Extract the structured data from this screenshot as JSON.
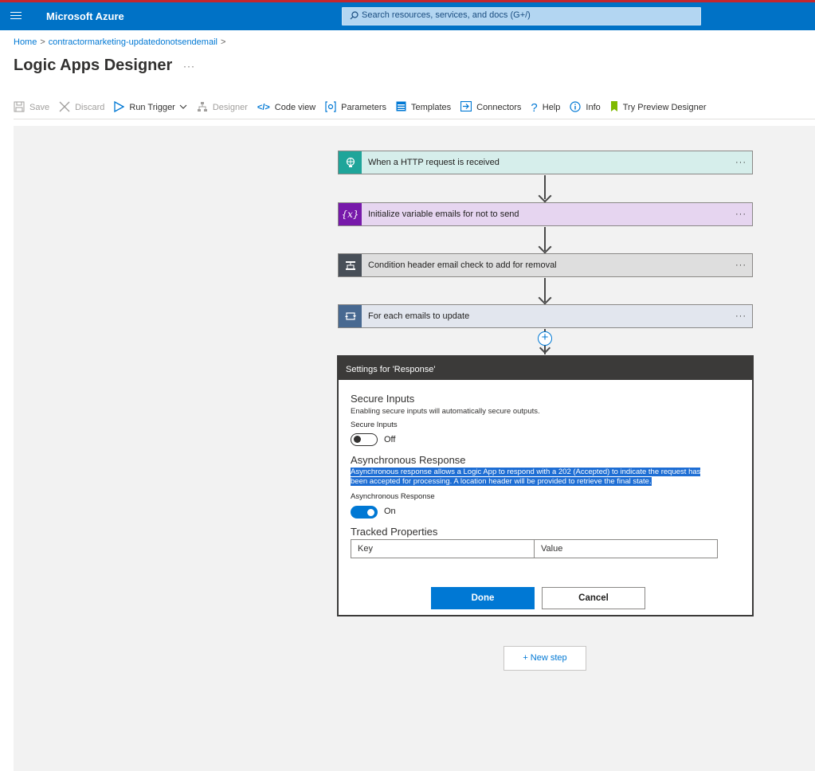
{
  "topbar": {
    "brand": "Microsoft Azure",
    "search_placeholder": "Search resources, services, and docs (G+/)"
  },
  "breadcrumb": {
    "home": "Home",
    "resource": "contractormarketing-updatedonotsendemail"
  },
  "page": {
    "title": "Logic Apps Designer",
    "more": "···"
  },
  "toolbar": {
    "save": "Save",
    "discard": "Discard",
    "run_trigger": "Run Trigger",
    "designer": "Designer",
    "code_view": "Code view",
    "parameters": "Parameters",
    "templates": "Templates",
    "connectors": "Connectors",
    "help": "Help",
    "info": "Info",
    "try_preview": "Try Preview Designer"
  },
  "steps": [
    {
      "label": "When a HTTP request is received",
      "icon": "http-request-icon",
      "color": "#1fa59a",
      "bg": "#d6eeeb"
    },
    {
      "label": "Initialize variable emails for not to send",
      "icon": "variable-icon",
      "color": "#7719aa",
      "bg": "#e6d5f0"
    },
    {
      "label": "Condition header email check to add for removal",
      "icon": "condition-icon",
      "color": "#484f58",
      "bg": "#dedede"
    },
    {
      "label": "For each emails to update",
      "icon": "foreach-icon",
      "color": "#486991",
      "bg": "#e2e6ee"
    }
  ],
  "step_more": "···",
  "panel": {
    "header": "Settings for 'Response'",
    "secure": {
      "title": "Secure Inputs",
      "desc": "Enabling secure inputs will automatically secure outputs.",
      "field_label": "Secure Inputs",
      "state": "Off"
    },
    "async": {
      "title": "Asynchronous Response",
      "desc_line1": "Asynchronous response allows a Logic App to respond with a 202 (Accepted) to indicate the request has",
      "desc_line2": "been accepted for processing. A location header will be provided to retrieve the final state.",
      "field_label": "Asynchronous Response",
      "state": "On"
    },
    "tracked": {
      "title": "Tracked Properties",
      "key_placeholder": "Key",
      "value_placeholder": "Value"
    },
    "done": "Done",
    "cancel": "Cancel"
  },
  "new_step": "+ New step",
  "colors": {
    "accent": "#0078d4",
    "topbar": "#0072c6",
    "try_preview_flag": "#7fba00"
  }
}
